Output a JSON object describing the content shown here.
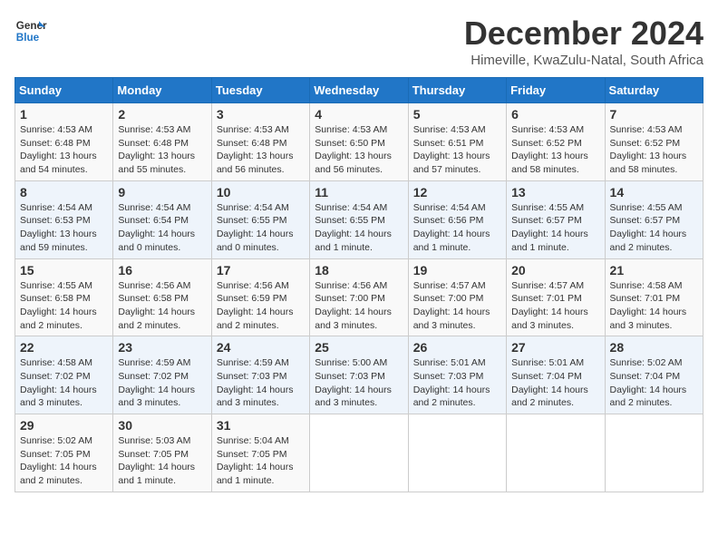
{
  "logo": {
    "line1": "General",
    "line2": "Blue"
  },
  "title": "December 2024",
  "subtitle": "Himeville, KwaZulu-Natal, South Africa",
  "days_of_week": [
    "Sunday",
    "Monday",
    "Tuesday",
    "Wednesday",
    "Thursday",
    "Friday",
    "Saturday"
  ],
  "weeks": [
    [
      {
        "day": 1,
        "info": "Sunrise: 4:53 AM\nSunset: 6:48 PM\nDaylight: 13 hours\nand 54 minutes."
      },
      {
        "day": 2,
        "info": "Sunrise: 4:53 AM\nSunset: 6:48 PM\nDaylight: 13 hours\nand 55 minutes."
      },
      {
        "day": 3,
        "info": "Sunrise: 4:53 AM\nSunset: 6:48 PM\nDaylight: 13 hours\nand 56 minutes."
      },
      {
        "day": 4,
        "info": "Sunrise: 4:53 AM\nSunset: 6:50 PM\nDaylight: 13 hours\nand 56 minutes."
      },
      {
        "day": 5,
        "info": "Sunrise: 4:53 AM\nSunset: 6:51 PM\nDaylight: 13 hours\nand 57 minutes."
      },
      {
        "day": 6,
        "info": "Sunrise: 4:53 AM\nSunset: 6:52 PM\nDaylight: 13 hours\nand 58 minutes."
      },
      {
        "day": 7,
        "info": "Sunrise: 4:53 AM\nSunset: 6:52 PM\nDaylight: 13 hours\nand 58 minutes."
      }
    ],
    [
      {
        "day": 8,
        "info": "Sunrise: 4:54 AM\nSunset: 6:53 PM\nDaylight: 13 hours\nand 59 minutes."
      },
      {
        "day": 9,
        "info": "Sunrise: 4:54 AM\nSunset: 6:54 PM\nDaylight: 14 hours\nand 0 minutes."
      },
      {
        "day": 10,
        "info": "Sunrise: 4:54 AM\nSunset: 6:55 PM\nDaylight: 14 hours\nand 0 minutes."
      },
      {
        "day": 11,
        "info": "Sunrise: 4:54 AM\nSunset: 6:55 PM\nDaylight: 14 hours\nand 1 minute."
      },
      {
        "day": 12,
        "info": "Sunrise: 4:54 AM\nSunset: 6:56 PM\nDaylight: 14 hours\nand 1 minute."
      },
      {
        "day": 13,
        "info": "Sunrise: 4:55 AM\nSunset: 6:57 PM\nDaylight: 14 hours\nand 1 minute."
      },
      {
        "day": 14,
        "info": "Sunrise: 4:55 AM\nSunset: 6:57 PM\nDaylight: 14 hours\nand 2 minutes."
      }
    ],
    [
      {
        "day": 15,
        "info": "Sunrise: 4:55 AM\nSunset: 6:58 PM\nDaylight: 14 hours\nand 2 minutes."
      },
      {
        "day": 16,
        "info": "Sunrise: 4:56 AM\nSunset: 6:58 PM\nDaylight: 14 hours\nand 2 minutes."
      },
      {
        "day": 17,
        "info": "Sunrise: 4:56 AM\nSunset: 6:59 PM\nDaylight: 14 hours\nand 2 minutes."
      },
      {
        "day": 18,
        "info": "Sunrise: 4:56 AM\nSunset: 7:00 PM\nDaylight: 14 hours\nand 3 minutes."
      },
      {
        "day": 19,
        "info": "Sunrise: 4:57 AM\nSunset: 7:00 PM\nDaylight: 14 hours\nand 3 minutes."
      },
      {
        "day": 20,
        "info": "Sunrise: 4:57 AM\nSunset: 7:01 PM\nDaylight: 14 hours\nand 3 minutes."
      },
      {
        "day": 21,
        "info": "Sunrise: 4:58 AM\nSunset: 7:01 PM\nDaylight: 14 hours\nand 3 minutes."
      }
    ],
    [
      {
        "day": 22,
        "info": "Sunrise: 4:58 AM\nSunset: 7:02 PM\nDaylight: 14 hours\nand 3 minutes."
      },
      {
        "day": 23,
        "info": "Sunrise: 4:59 AM\nSunset: 7:02 PM\nDaylight: 14 hours\nand 3 minutes."
      },
      {
        "day": 24,
        "info": "Sunrise: 4:59 AM\nSunset: 7:03 PM\nDaylight: 14 hours\nand 3 minutes."
      },
      {
        "day": 25,
        "info": "Sunrise: 5:00 AM\nSunset: 7:03 PM\nDaylight: 14 hours\nand 3 minutes."
      },
      {
        "day": 26,
        "info": "Sunrise: 5:01 AM\nSunset: 7:03 PM\nDaylight: 14 hours\nand 2 minutes."
      },
      {
        "day": 27,
        "info": "Sunrise: 5:01 AM\nSunset: 7:04 PM\nDaylight: 14 hours\nand 2 minutes."
      },
      {
        "day": 28,
        "info": "Sunrise: 5:02 AM\nSunset: 7:04 PM\nDaylight: 14 hours\nand 2 minutes."
      }
    ],
    [
      {
        "day": 29,
        "info": "Sunrise: 5:02 AM\nSunset: 7:05 PM\nDaylight: 14 hours\nand 2 minutes."
      },
      {
        "day": 30,
        "info": "Sunrise: 5:03 AM\nSunset: 7:05 PM\nDaylight: 14 hours\nand 1 minute."
      },
      {
        "day": 31,
        "info": "Sunrise: 5:04 AM\nSunset: 7:05 PM\nDaylight: 14 hours\nand 1 minute."
      },
      null,
      null,
      null,
      null
    ]
  ]
}
